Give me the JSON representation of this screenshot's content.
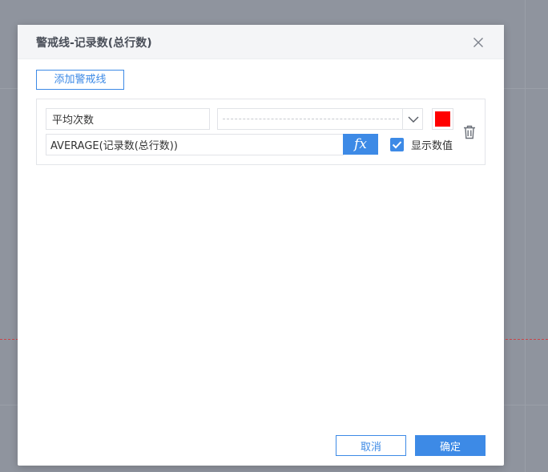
{
  "dialog": {
    "title": "警戒线-记录数(总行数)",
    "add_button_label": "添加警戒线",
    "cancel_label": "取消",
    "ok_label": "确定"
  },
  "warning_line": {
    "name": "平均次数",
    "line_style": "dashed",
    "color": "#ff0000",
    "formula": "AVERAGE(记录数(总行数))",
    "fx_label": "fx",
    "show_value_label": "显示数值",
    "show_value_checked": true
  },
  "icons": {
    "close": "close-icon",
    "dropdown": "chevron-down-icon",
    "delete": "trash-icon",
    "check": "check-icon"
  },
  "colors": {
    "accent": "#3d8ae6",
    "backdrop": "#8f949e"
  }
}
